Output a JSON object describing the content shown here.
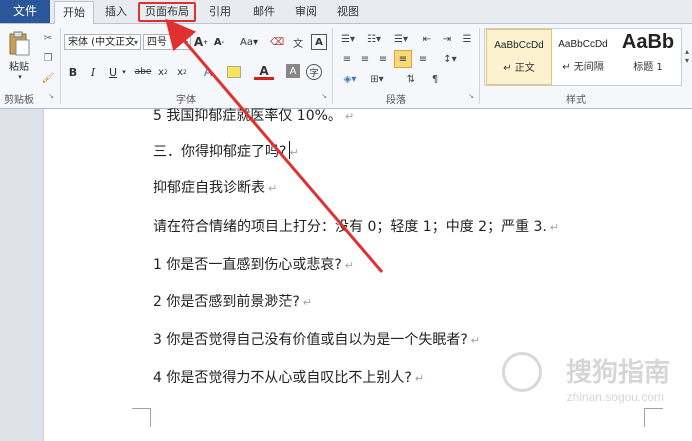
{
  "tabs": {
    "file": "文件",
    "home": "开始",
    "insert": "插入",
    "layout": "页面布局",
    "references": "引用",
    "mailings": "邮件",
    "review": "审阅",
    "view": "视图"
  },
  "ribbon": {
    "clipboard": {
      "paste_label": "粘贴",
      "group_label": "剪贴板"
    },
    "font": {
      "font_name": "宋体 (中文正文",
      "font_size": "四号",
      "group_label": "字体",
      "case_label": "Aa",
      "strike_label": "abe"
    },
    "paragraph": {
      "group_label": "段落"
    },
    "styles": {
      "group_label": "样式",
      "items": [
        {
          "sample": "AaBbCcDd",
          "name": "↵ 正文"
        },
        {
          "sample": "AaBbCcDd",
          "name": "↵ 无间隔"
        },
        {
          "sample": "AaBb",
          "name": "标题 1"
        }
      ]
    }
  },
  "document": {
    "lines": [
      "5 我国抑郁症就医率仅 10%。",
      "三．你得抑郁症了吗?",
      "抑郁症自我诊断表",
      "请在符合情绪的项目上打分：没有 0；轻度 1；中度 2；严重 3.",
      "1 你是否一直感到伤心或悲哀?",
      "2 你是否感到前景渺茫?",
      "3 你是否觉得自己没有价值或自以为是一个失眠者?",
      "4 你是否觉得力不从心或自叹比不上别人?"
    ],
    "paragraph_mark": "↵"
  },
  "watermark": {
    "text": "搜狗指南",
    "url": "zhinan.sogou.com"
  },
  "colors": {
    "file_tab": "#2b579a",
    "highlight": "#e03030",
    "arrow": "#e03030"
  }
}
